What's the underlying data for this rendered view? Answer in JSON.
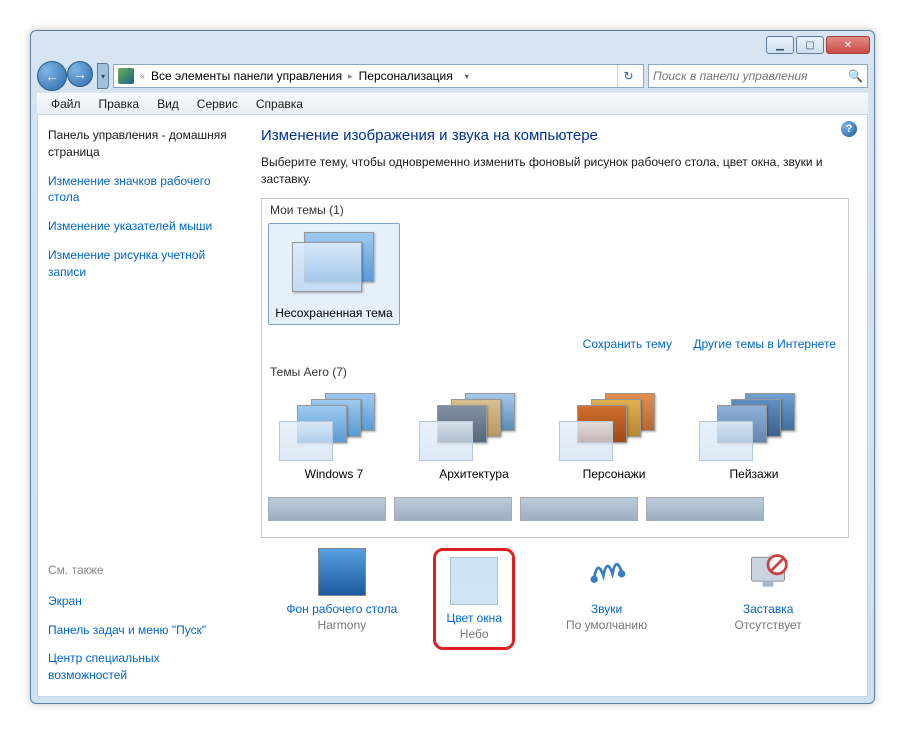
{
  "breadcrumb": {
    "prev": "Все элементы панели управления",
    "current": "Персонализация"
  },
  "search": {
    "placeholder": "Поиск в панели управления"
  },
  "menu": {
    "file": "Файл",
    "edit": "Правка",
    "view": "Вид",
    "tools": "Сервис",
    "help": "Справка"
  },
  "sidebar": {
    "home": "Панель управления - домашняя страница",
    "links": [
      "Изменение значков рабочего стола",
      "Изменение указателей мыши",
      "Изменение рисунка учетной записи"
    ],
    "seealso_hdr": "См. также",
    "seealso": [
      "Экран",
      "Панель задач и меню \"Пуск\"",
      "Центр специальных возможностей"
    ]
  },
  "main": {
    "heading": "Изменение изображения и звука на компьютере",
    "desc": "Выберите тему, чтобы одновременно изменить фоновый рисунок рабочего стола, цвет окна, звуки и заставку.",
    "mythemes_hdr": "Мои темы (1)",
    "mytheme": "Несохраненная тема",
    "save_link": "Сохранить тему",
    "online_link": "Другие темы в Интернете",
    "aero_hdr": "Темы Aero (7)",
    "aero": [
      "Windows 7",
      "Архитектура",
      "Персонажи",
      "Пейзажи"
    ]
  },
  "bottom": {
    "bg": {
      "label": "Фон рабочего стола",
      "value": "Harmony"
    },
    "wc": {
      "label": "Цвет окна",
      "value": "Небо"
    },
    "snd": {
      "label": "Звуки",
      "value": "По умолчанию"
    },
    "ss": {
      "label": "Заставка",
      "value": "Отсутствует"
    }
  }
}
